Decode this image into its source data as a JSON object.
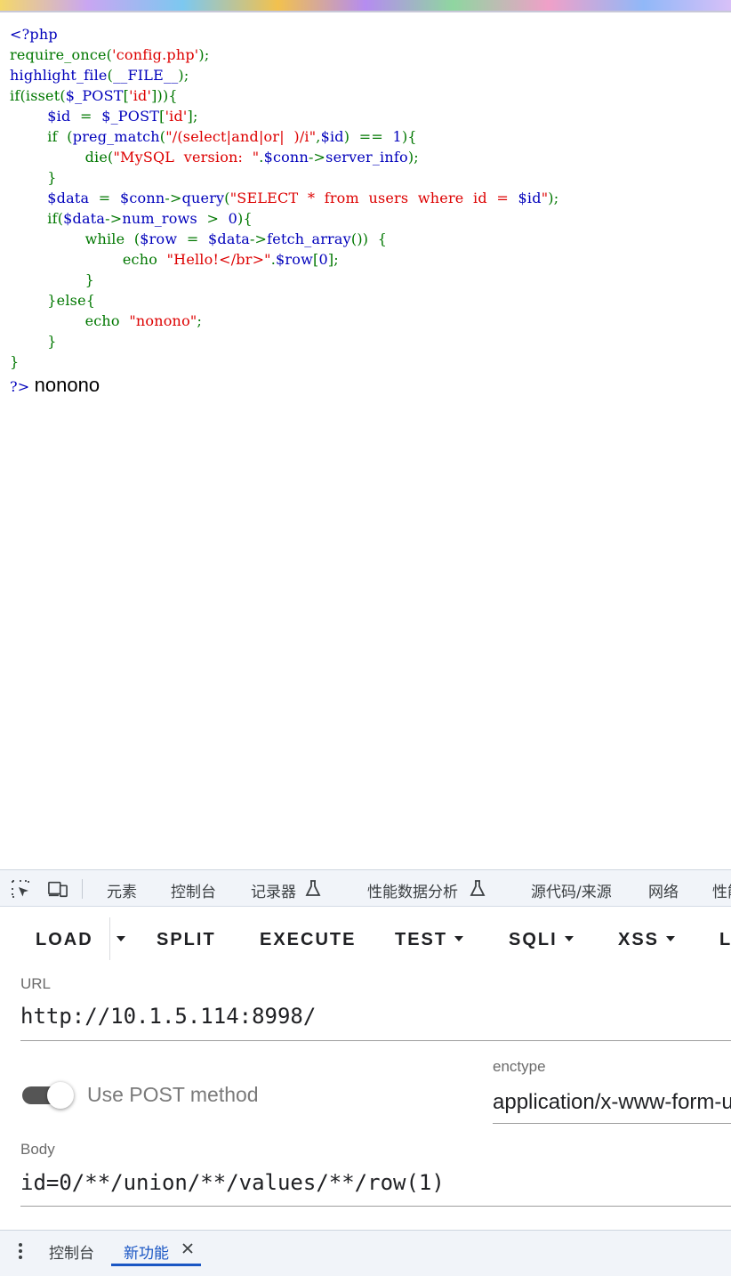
{
  "code_lines": [
    [
      {
        "c": "d",
        "t": "<?php"
      }
    ],
    [
      {
        "c": "k",
        "t": "require_once("
      },
      {
        "c": "s",
        "t": "'config.php'"
      },
      {
        "c": "k",
        "t": ");"
      }
    ],
    [
      {
        "c": "d",
        "t": "highlight_file"
      },
      {
        "c": "k",
        "t": "("
      },
      {
        "c": "d",
        "t": "__FILE__"
      },
      {
        "c": "k",
        "t": ");"
      }
    ],
    [
      {
        "c": "k",
        "t": "if(isset("
      },
      {
        "c": "d",
        "t": "$_POST"
      },
      {
        "c": "k",
        "t": "["
      },
      {
        "c": "s",
        "t": "'id'"
      },
      {
        "c": "k",
        "t": "])){"
      }
    ],
    [
      {
        "c": "k",
        "t": "        "
      },
      {
        "c": "d",
        "t": "$id "
      },
      {
        "c": "k",
        "t": " = "
      },
      {
        "c": "d",
        "t": " $_POST"
      },
      {
        "c": "k",
        "t": "["
      },
      {
        "c": "s",
        "t": "'id'"
      },
      {
        "c": "k",
        "t": "];"
      }
    ],
    [
      {
        "c": "k",
        "t": "        if  ("
      },
      {
        "c": "d",
        "t": "preg_match"
      },
      {
        "c": "k",
        "t": "("
      },
      {
        "c": "s",
        "t": "\"/(select|and|or|  )/i\""
      },
      {
        "c": "k",
        "t": ","
      },
      {
        "c": "d",
        "t": "$id"
      },
      {
        "c": "k",
        "t": ")  ==  "
      },
      {
        "c": "d",
        "t": "1"
      },
      {
        "c": "k",
        "t": "){"
      }
    ],
    [
      {
        "c": "k",
        "t": "                die("
      },
      {
        "c": "s",
        "t": "\"MySQL  version:  \""
      },
      {
        "c": "k",
        "t": "."
      },
      {
        "c": "d",
        "t": "$conn"
      },
      {
        "c": "k",
        "t": "->"
      },
      {
        "c": "d",
        "t": "server_info"
      },
      {
        "c": "k",
        "t": ");"
      }
    ],
    [
      {
        "c": "k",
        "t": "        }"
      }
    ],
    [
      {
        "c": "k",
        "t": "        "
      },
      {
        "c": "d",
        "t": "$data "
      },
      {
        "c": "k",
        "t": " = "
      },
      {
        "c": "d",
        "t": " $conn"
      },
      {
        "c": "k",
        "t": "->"
      },
      {
        "c": "d",
        "t": "query"
      },
      {
        "c": "k",
        "t": "("
      },
      {
        "c": "s",
        "t": "\"SELECT  *  from  users  where  id  =  "
      },
      {
        "c": "d",
        "t": "$id"
      },
      {
        "c": "s",
        "t": "\""
      },
      {
        "c": "k",
        "t": ");"
      }
    ],
    [
      {
        "c": "k",
        "t": "        if("
      },
      {
        "c": "d",
        "t": "$data"
      },
      {
        "c": "k",
        "t": "->"
      },
      {
        "c": "d",
        "t": "num_rows "
      },
      {
        "c": "k",
        "t": " >  "
      },
      {
        "c": "d",
        "t": "0"
      },
      {
        "c": "k",
        "t": "){"
      }
    ],
    [
      {
        "c": "k",
        "t": "                while  ("
      },
      {
        "c": "d",
        "t": "$row "
      },
      {
        "c": "k",
        "t": " = "
      },
      {
        "c": "d",
        "t": " $data"
      },
      {
        "c": "k",
        "t": "->"
      },
      {
        "c": "d",
        "t": "fetch_array"
      },
      {
        "c": "k",
        "t": "())  {"
      }
    ],
    [
      {
        "c": "k",
        "t": "                        echo  "
      },
      {
        "c": "s",
        "t": "\"Hello!</br>\""
      },
      {
        "c": "k",
        "t": "."
      },
      {
        "c": "d",
        "t": "$row"
      },
      {
        "c": "k",
        "t": "["
      },
      {
        "c": "d",
        "t": "0"
      },
      {
        "c": "k",
        "t": "];"
      }
    ],
    [
      {
        "c": "k",
        "t": "                }"
      }
    ],
    [
      {
        "c": "k",
        "t": "        }else{"
      }
    ],
    [
      {
        "c": "k",
        "t": "                echo  "
      },
      {
        "c": "s",
        "t": "\"nonono\""
      },
      {
        "c": "k",
        "t": ";"
      }
    ],
    [
      {
        "c": "k",
        "t": "        }"
      }
    ],
    [
      {
        "c": "k",
        "t": "}"
      }
    ]
  ],
  "code_end": "?>",
  "page_output": "nonono",
  "devtools": {
    "tabs": [
      "元素",
      "控制台",
      "记录器",
      "性能数据分析",
      "源代码/来源",
      "网络",
      "性能"
    ],
    "inspect_icon": "inspect-element-icon",
    "device_icon": "device-toggle-icon",
    "flask_icon": "experiment-flask-icon"
  },
  "hackbar": {
    "buttons": [
      "LOAD",
      "SPLIT",
      "EXECUTE",
      "TEST",
      "SQLI",
      "XSS",
      "L"
    ],
    "url_label": "URL",
    "url_value": "http://10.1.5.114:8998/",
    "post_toggle_label": "Use POST method",
    "post_enabled": true,
    "enctype_label": "enctype",
    "enctype_value": "application/x-www-form-urlencoded",
    "body_label": "Body",
    "body_value": "id=0/**/union/**/values/**/row(1)"
  },
  "drawer": {
    "menu_icon": "more-vertical-icon",
    "tab_console": "控制台",
    "tab_whats_new": "新功能",
    "close_icon": "close-icon"
  }
}
